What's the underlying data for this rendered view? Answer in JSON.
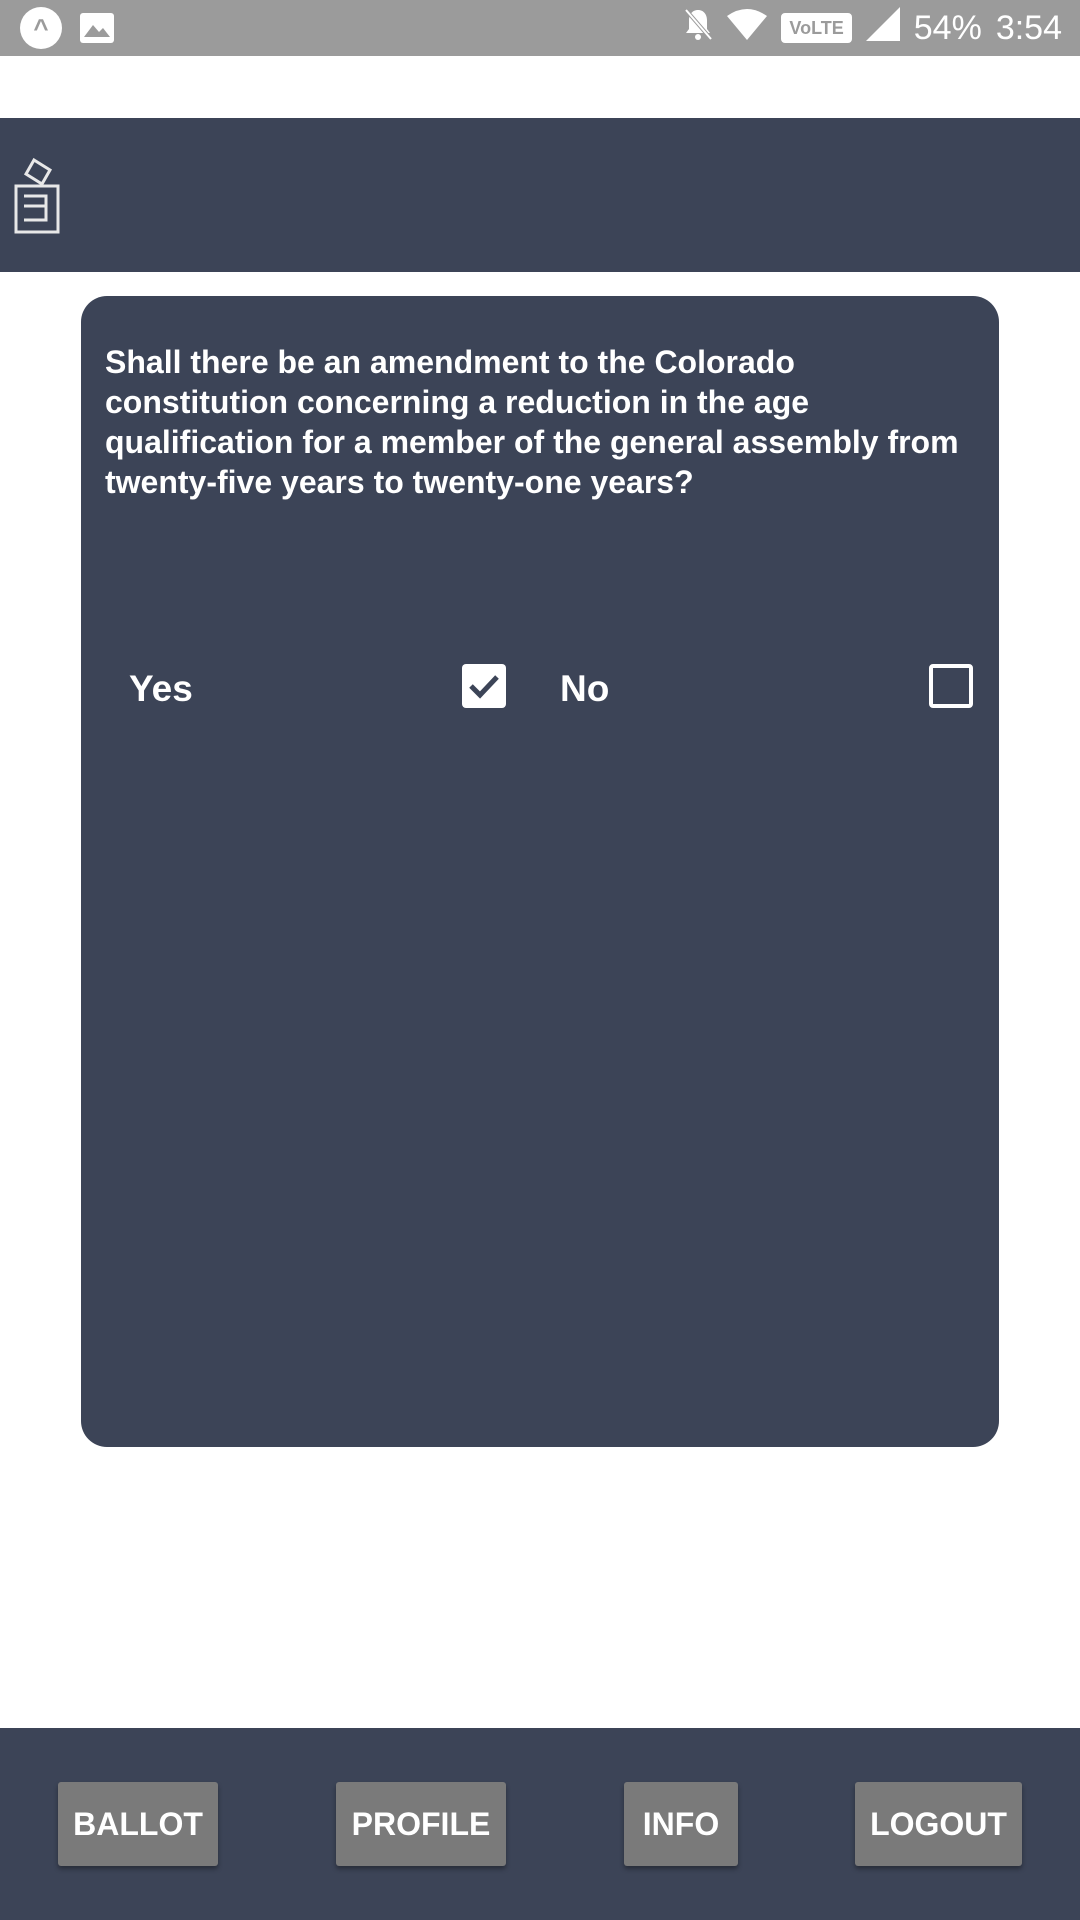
{
  "status_bar": {
    "left_icons": [
      "app-notification-icon",
      "image-icon"
    ],
    "right_icons": [
      "bell-muted-icon",
      "wifi-icon",
      "signal-icon"
    ],
    "volte_label": "VoLTE",
    "battery": "54%",
    "time": "3:54"
  },
  "header": {
    "logo_icon": "ballot-box-icon"
  },
  "ballot": {
    "question": "Shall there be an amendment to the Colorado constitution concerning a reduction in the age qualification for a member of the general assembly from twenty-five years to twenty-one years?",
    "options": [
      {
        "label": "Yes",
        "checked": true
      },
      {
        "label": "No",
        "checked": false
      }
    ]
  },
  "nav": {
    "ballot_label": "BALLOT",
    "profile_label": "PROFILE",
    "info_label": "INFO",
    "logout_label": "LOGOUT"
  },
  "colors": {
    "primary": "#3c4457",
    "button": "#7a7a7a",
    "status_bar": "#9b9b9b"
  }
}
